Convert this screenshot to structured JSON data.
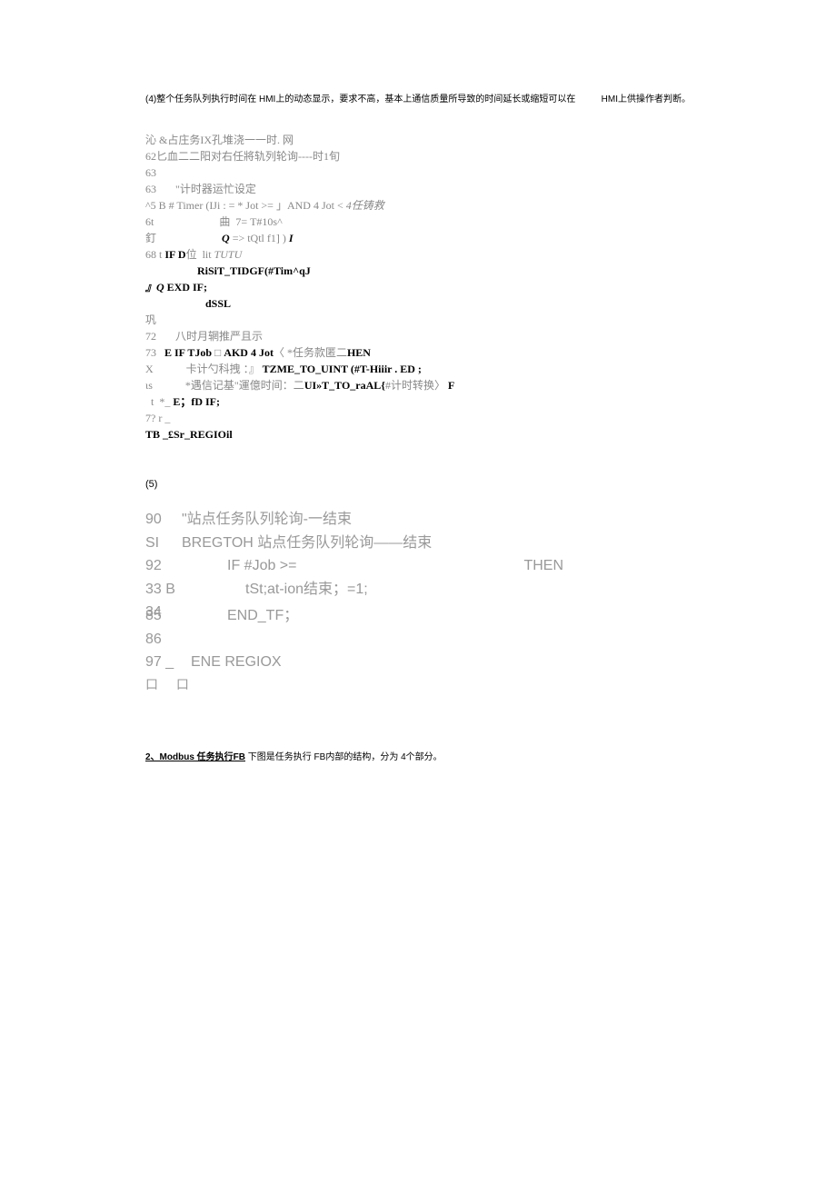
{
  "header": {
    "left": "(4)整个任务队列执行时间在 HMI上的动态显示，要求不高，基本上通信质量所导致的时间延长或缩短可以在",
    "right": "HMI上供操作者判断。"
  },
  "code1": {
    "l1": "沁 &占庄务IX孔堆浇一一时. 网",
    "l2_prefix": "62",
    "l2": "匕血二二阳对右任將轨列轮询----时1旬",
    "l3": "63",
    "l4_prefix": "63",
    "l4": "       \"计时器运忙设定",
    "l5": "^5 B # Timer (IJi : = * Jot >= 」AND 4 Jot < ",
    "l5_italic": "4任铸救",
    "l6": "6t                        曲  7= T#10s^",
    "l7_prefix": "釘                        ",
    "l7_italic": "Q",
    "l7_rest": " => tQtl f1] ) ",
    "l7_italic2": "I",
    "l8_prefix": "68 t ",
    "l8_bold": "IF D",
    "l8_mid": "位  lit ",
    "l8_italic": "TUTU",
    "l9": "                   RiSiT_TIDGF(#Tim^qJ",
    "l10_italic": "』Q",
    "l10_bold": " EXD IF;",
    "l11": "                      dSSL",
    "l12": "巩",
    "l13_prefix": "72",
    "l13": "       八时月辋推严且示",
    "l14_prefix": "73   ",
    "l14_bold1": "E IF TJob",
    "l14_mid": " □ ",
    "l14_bold2": "AKD 4 Jot",
    "l14_rest": "〈 *任务款匿二",
    "l14_bold3": "HEN",
    "l15_prefix": "X            卡计勺科拽 ：』 ",
    "l15_bold": "TZME_TO_UINT (#T-Hiiir . ED ;",
    "l16_prefix": "ιs",
    "l16_mid": "            *遇信记基\"運億时间：二",
    "l16_bold": "UI»T_TO_raAL{",
    "l16_rest": "#计时转换〉 ",
    "l16_bold2": "F",
    "l17_prefix": "  t  *_ ",
    "l17_bold": "E；fD IF;",
    "l18": "7? r _",
    "l19": "TB _£Sr_REGIOil"
  },
  "section5": "(5)",
  "code2": {
    "rows": [
      {
        "ln": "90",
        "txt": "\"站点任务队列轮询-一结束"
      },
      {
        "ln": "SI",
        "txt": "BREGTOH 站点任务队列轮询——结束"
      },
      {
        "ln": "92",
        "txt": "IF #Job >=",
        "then": "THEN",
        "indent": true
      },
      {
        "ln": "33",
        "extra": "B",
        "txt": "tSt;at-ion结束；=1;",
        "indent2": true
      },
      {
        "ln": "34",
        "txt": "",
        "indent": true
      },
      {
        "ln": "85",
        "txt": "END_TF；",
        "indent": true,
        "shift": true
      },
      {
        "ln": "86",
        "txt": ""
      },
      {
        "ln": "97",
        "extra": "_",
        "txt": "ENE REGIOX"
      }
    ],
    "boxes": "口 口"
  },
  "footer": {
    "underline_part": "2、Modbus 任务执行FB",
    "rest": " 下图是任务执行 FB内部的结构，分为 4个部分。"
  }
}
